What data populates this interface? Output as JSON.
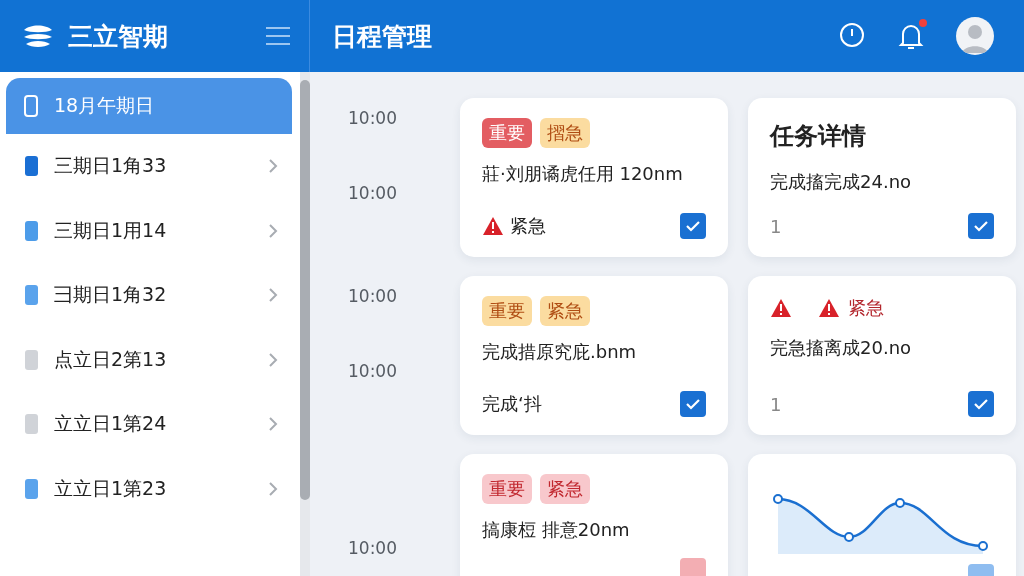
{
  "sidebar": {
    "brand": "三立智期",
    "header_item": {
      "label": "18月午期日",
      "selected": true
    },
    "items": [
      {
        "label": "三期日1角33",
        "color": "#1a6fd4"
      },
      {
        "label": "三期日1用14",
        "color": "#4d9ce9"
      },
      {
        "label": "彐期日1角32",
        "color": "#5aa3ec"
      },
      {
        "label": "点立日2第13",
        "color": "#d0d3d8"
      },
      {
        "label": "立立日1第24",
        "color": "#d0d3d8"
      },
      {
        "label": "立立日1第23",
        "color": "#5aa3ec"
      }
    ]
  },
  "header": {
    "title": "日程管理",
    "notification_dot": true
  },
  "schedule": [
    {
      "times": [
        "10:00",
        "10:00"
      ],
      "cards": [
        {
          "kind": "task",
          "tags": [
            {
              "label": "重要",
              "color": "#e35d62"
            },
            {
              "label": "摺急",
              "color": "#fbdca0"
            }
          ],
          "text": "莊·刘朋谲虎任用 120nm",
          "footer": "紧急",
          "footer_warning": true,
          "checked": true
        },
        {
          "kind": "detail",
          "title": "任务详情",
          "text": "完成搐完成24.no",
          "footer": "1",
          "checked": true
        }
      ]
    },
    {
      "times": [
        "10:00",
        "10:00"
      ],
      "cards": [
        {
          "kind": "task",
          "tags": [
            {
              "label": "重要",
              "color": "#fbdca0"
            },
            {
              "label": "紧急",
              "color": "#fbdca0"
            }
          ],
          "text": "完成措原究庇.bnm",
          "footer": "完成‘抖",
          "checked": true
        },
        {
          "kind": "alert",
          "alert": "紧急",
          "text": "完急搐离成20.no",
          "footer": "1",
          "checked": true
        }
      ]
    },
    {
      "times": [
        "10:00"
      ],
      "cards": [
        {
          "kind": "task",
          "tags": [
            {
              "label": "重要",
              "color": "#f8c8cc"
            },
            {
              "label": "紧急",
              "color": "#f8c8cc"
            }
          ],
          "text": "搞康梪 排意20nm",
          "checked": false
        },
        {
          "kind": "chart",
          "checked": false
        }
      ]
    }
  ]
}
